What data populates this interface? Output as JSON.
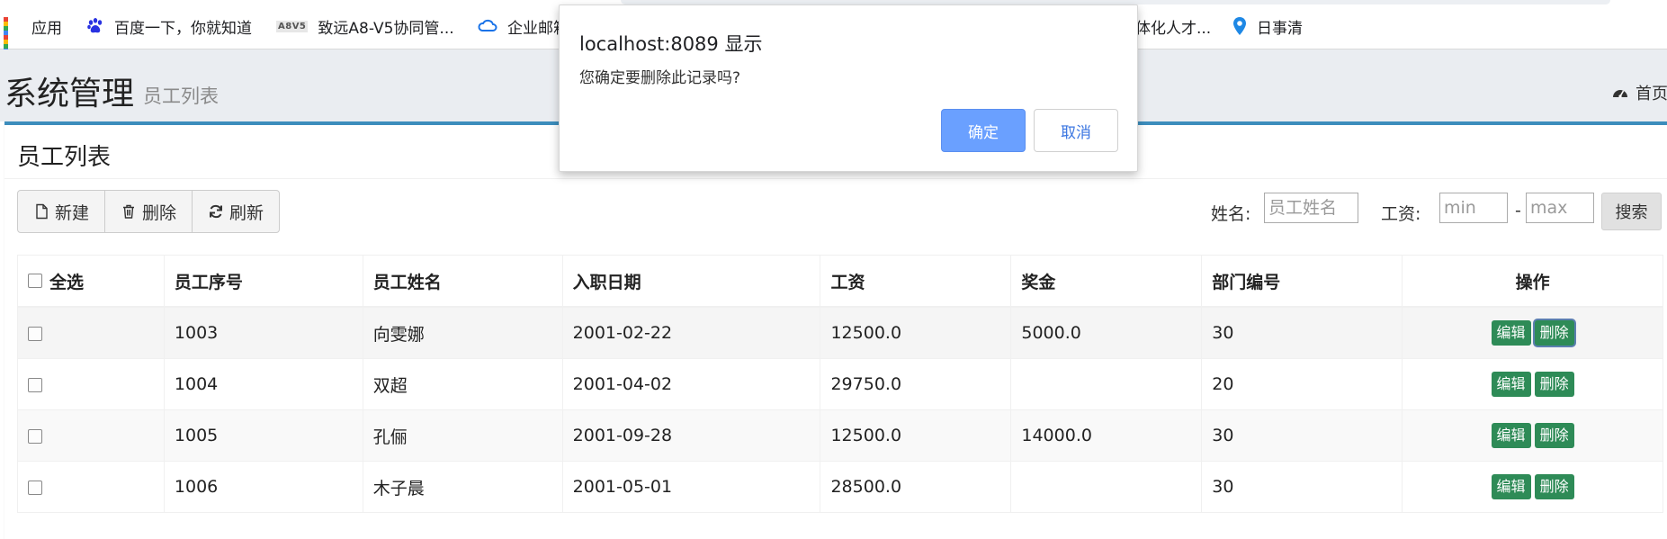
{
  "bookmarks": [
    {
      "label": "应用",
      "icon": "apps-grid-icon"
    },
    {
      "label": "百度一下，你就知道",
      "icon": "baidu-paw-icon"
    },
    {
      "label": "致远A8-V5协同管...",
      "icon": "a8-logo-icon"
    },
    {
      "label": "企业邮箱",
      "icon": "cloud-icon"
    },
    {
      "label": "体化人才...",
      "icon": ""
    },
    {
      "label": "日事清",
      "icon": "location-pin-icon"
    }
  ],
  "header": {
    "title": "系统管理",
    "subtitle": "员工列表",
    "home_label": "首页"
  },
  "box": {
    "title": "员工列表"
  },
  "toolbar": {
    "new_label": "新建",
    "delete_label": "删除",
    "refresh_label": "刷新"
  },
  "search": {
    "name_label": "姓名:",
    "name_placeholder": "员工姓名",
    "salary_label": "工资:",
    "min_placeholder": "min",
    "dash": "-",
    "max_placeholder": "max",
    "button_label": "搜索"
  },
  "table": {
    "headers": [
      "全选",
      "员工序号",
      "员工姓名",
      "入职日期",
      "工资",
      "奖金",
      "部门编号",
      "操作"
    ],
    "rows": [
      {
        "id": "1003",
        "name": "向雯娜",
        "hire_date": "2001-02-22",
        "salary": "12500.0",
        "bonus": "5000.0",
        "dept": "30"
      },
      {
        "id": "1004",
        "name": "双超",
        "hire_date": "2001-04-02",
        "salary": "29750.0",
        "bonus": "",
        "dept": "20"
      },
      {
        "id": "1005",
        "name": "孔俪",
        "hire_date": "2001-09-28",
        "salary": "12500.0",
        "bonus": "14000.0",
        "dept": "30"
      },
      {
        "id": "1006",
        "name": "木子晨",
        "hire_date": "2001-05-01",
        "salary": "28500.0",
        "bonus": "",
        "dept": "30"
      }
    ],
    "edit_label": "编辑",
    "delete_label": "删除"
  },
  "dialog": {
    "title": "localhost:8089 显示",
    "message": "您确定要删除此记录吗?",
    "ok_label": "确定",
    "cancel_label": "取消"
  },
  "colors": {
    "accent": "#3c8dbc",
    "action_green": "#2e8b57",
    "dialog_ok": "#6aa0ff"
  }
}
